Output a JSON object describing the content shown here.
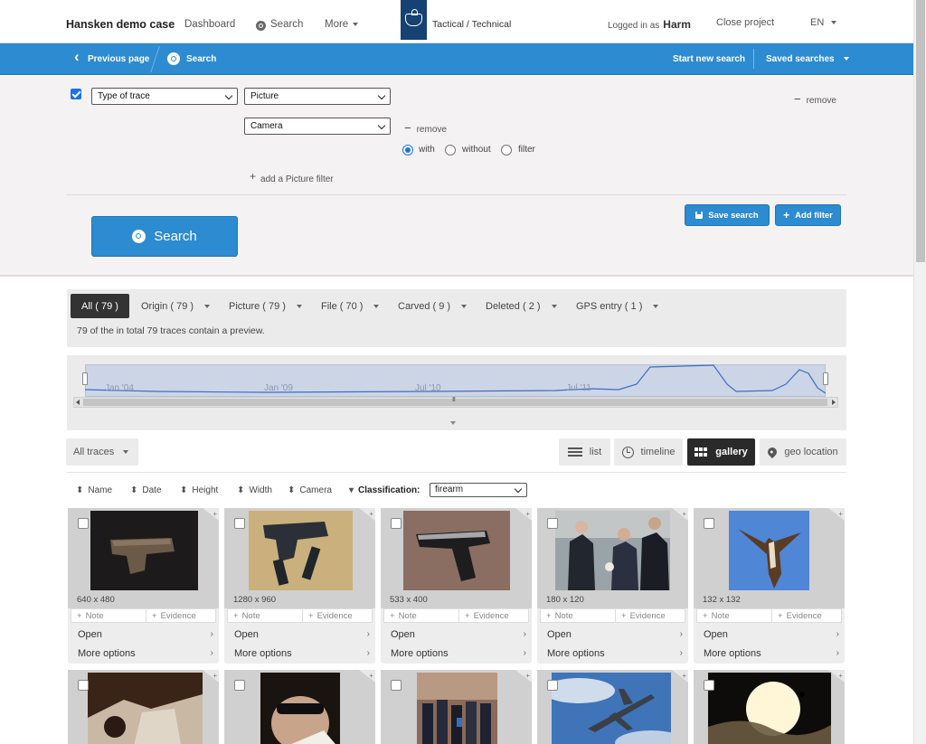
{
  "header": {
    "brand": "Hansken demo case",
    "nav_dashboard": "Dashboard",
    "nav_search": "Search",
    "nav_more": "More",
    "logo_title": "Tactical / Technical",
    "logged_in_label": "Logged in as",
    "user": "Harm",
    "close_project": "Close project",
    "language": "EN"
  },
  "breadcrumb": {
    "previous": "Previous page",
    "current": "Search",
    "start_new": "Start new search",
    "saved_searches": "Saved searches"
  },
  "filter": {
    "type_of_trace": "Type of trace",
    "picture": "Picture",
    "camera": "Camera",
    "remove": "remove",
    "remove2": "remove",
    "radio_with": "with",
    "radio_without": "without",
    "radio_filter": "filter",
    "add_picture_filter": "add a Picture filter",
    "save_search": "Save search",
    "add_filter": "Add filter",
    "search_button": "Search"
  },
  "tabs": [
    {
      "label": "All ( 79 )"
    },
    {
      "label": "Origin ( 79 )"
    },
    {
      "label": "Picture ( 79 )"
    },
    {
      "label": "File ( 70 )"
    },
    {
      "label": "Carved ( 9 )"
    },
    {
      "label": "Deleted ( 2 )"
    },
    {
      "label": "GPS entry ( 1 )"
    }
  ],
  "tabs_info": "79 of the in total 79 traces contain a preview.",
  "timeline": {
    "labels": [
      "Jan '04",
      "Jan '09",
      "Jul '10",
      "Jul '11"
    ]
  },
  "view": {
    "all_traces": "All traces",
    "list": "list",
    "timeline": "timeline",
    "gallery": "gallery",
    "geo": "geo location"
  },
  "sort": {
    "name": "Name",
    "date": "Date",
    "height": "Height",
    "width": "Width",
    "camera": "Camera",
    "classification": "Classification:",
    "classification_value": "firearm"
  },
  "cards": [
    {
      "dims": "640 x 480",
      "note": "Note",
      "evidence": "Evidence",
      "open": "Open",
      "more": "More options"
    },
    {
      "dims": "1280 x 960",
      "note": "Note",
      "evidence": "Evidence",
      "open": "Open",
      "more": "More options"
    },
    {
      "dims": "533 x 400",
      "note": "Note",
      "evidence": "Evidence",
      "open": "Open",
      "more": "More options"
    },
    {
      "dims": "180 x 120",
      "note": "Note",
      "evidence": "Evidence",
      "open": "Open",
      "more": "More options"
    },
    {
      "dims": "132 x 132",
      "note": "Note",
      "evidence": "Evidence",
      "open": "Open",
      "more": "More options"
    }
  ],
  "colors": {
    "accent": "#2c8bd1",
    "logo_bg": "#154273",
    "active_dark": "#2a2a2a"
  }
}
